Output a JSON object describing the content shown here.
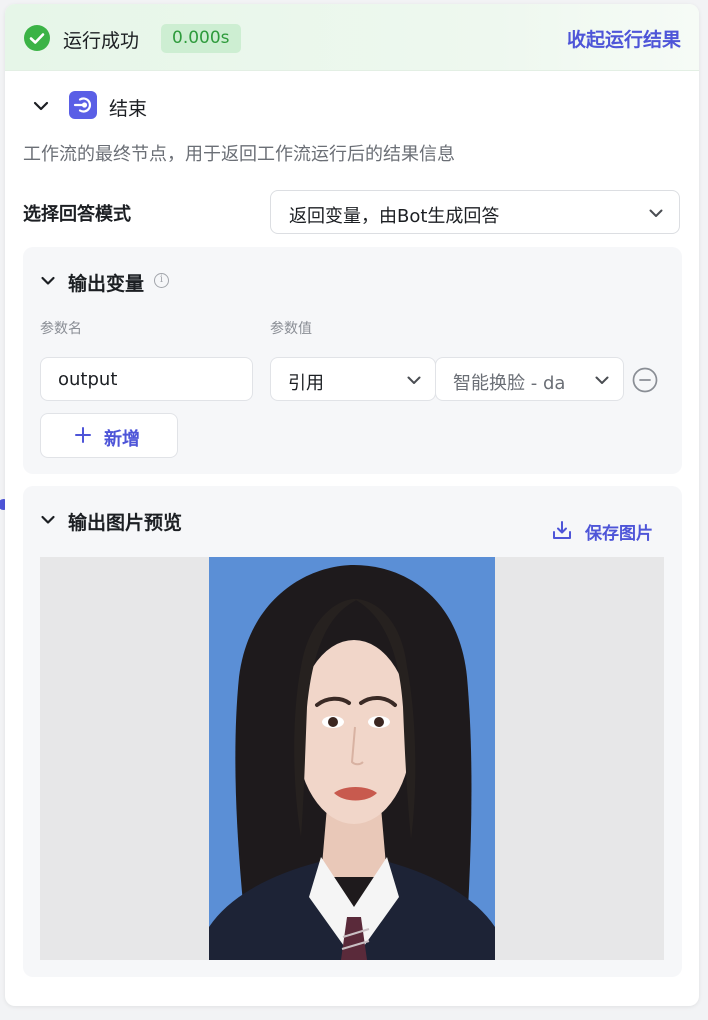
{
  "status": {
    "text": "运行成功",
    "duration": "0.000s",
    "collapse_label": "收起运行结果"
  },
  "node": {
    "title": "结束",
    "description": "工作流的最终节点，用于返回工作流运行后的结果信息"
  },
  "answer_mode": {
    "label": "选择回答模式",
    "selected": "返回变量，由Bot生成回答"
  },
  "output_vars": {
    "title": "输出变量",
    "col_name": "参数名",
    "col_value": "参数值",
    "rows": [
      {
        "name": "output",
        "type": "引用",
        "value": "智能换脸 - da"
      }
    ],
    "add_label": "新增"
  },
  "preview": {
    "title": "输出图片预览",
    "save_label": "保存图片"
  },
  "colors": {
    "accent": "#4e55d8",
    "success": "#3bb346",
    "photo_background": "#5b8fd6"
  }
}
